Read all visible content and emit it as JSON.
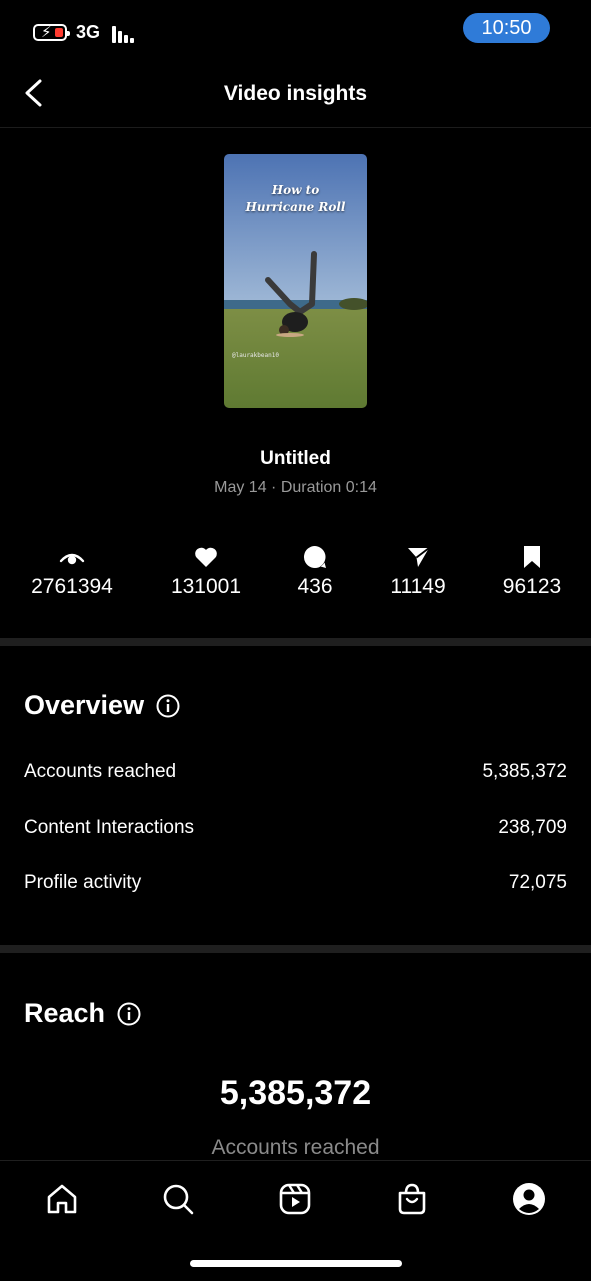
{
  "status_bar": {
    "network": "3G",
    "time": "10:50"
  },
  "header": {
    "title": "Video insights",
    "back_icon": "chevron-left-icon"
  },
  "video": {
    "thumbnail_caption_line1": "How to",
    "thumbnail_caption_line2": "Hurricane Roll",
    "thumbnail_handle": "@laurakbean10",
    "title": "Untitled",
    "meta": "May 14 · Duration 0:14"
  },
  "metrics": [
    {
      "icon": "eye-icon",
      "value": "2761394"
    },
    {
      "icon": "heart-icon",
      "value": "131001"
    },
    {
      "icon": "comment-icon",
      "value": "436"
    },
    {
      "icon": "share-icon",
      "value": "11149"
    },
    {
      "icon": "bookmark-icon",
      "value": "96123"
    }
  ],
  "overview": {
    "title": "Overview",
    "rows": [
      {
        "label": "Accounts reached",
        "value": "5,385,372"
      },
      {
        "label": "Content Interactions",
        "value": "238,709"
      },
      {
        "label": "Profile activity",
        "value": "72,075"
      }
    ]
  },
  "reach": {
    "title": "Reach",
    "big_value": "5,385,372",
    "sub_label": "Accounts reached"
  },
  "bottom_nav": [
    "home-icon",
    "search-icon",
    "reels-icon",
    "shop-icon",
    "profile-icon"
  ],
  "colors": {
    "time_pill": "#2f7bd8",
    "battery_low": "#ff3b30",
    "muted_text": "#9a9a9a"
  }
}
